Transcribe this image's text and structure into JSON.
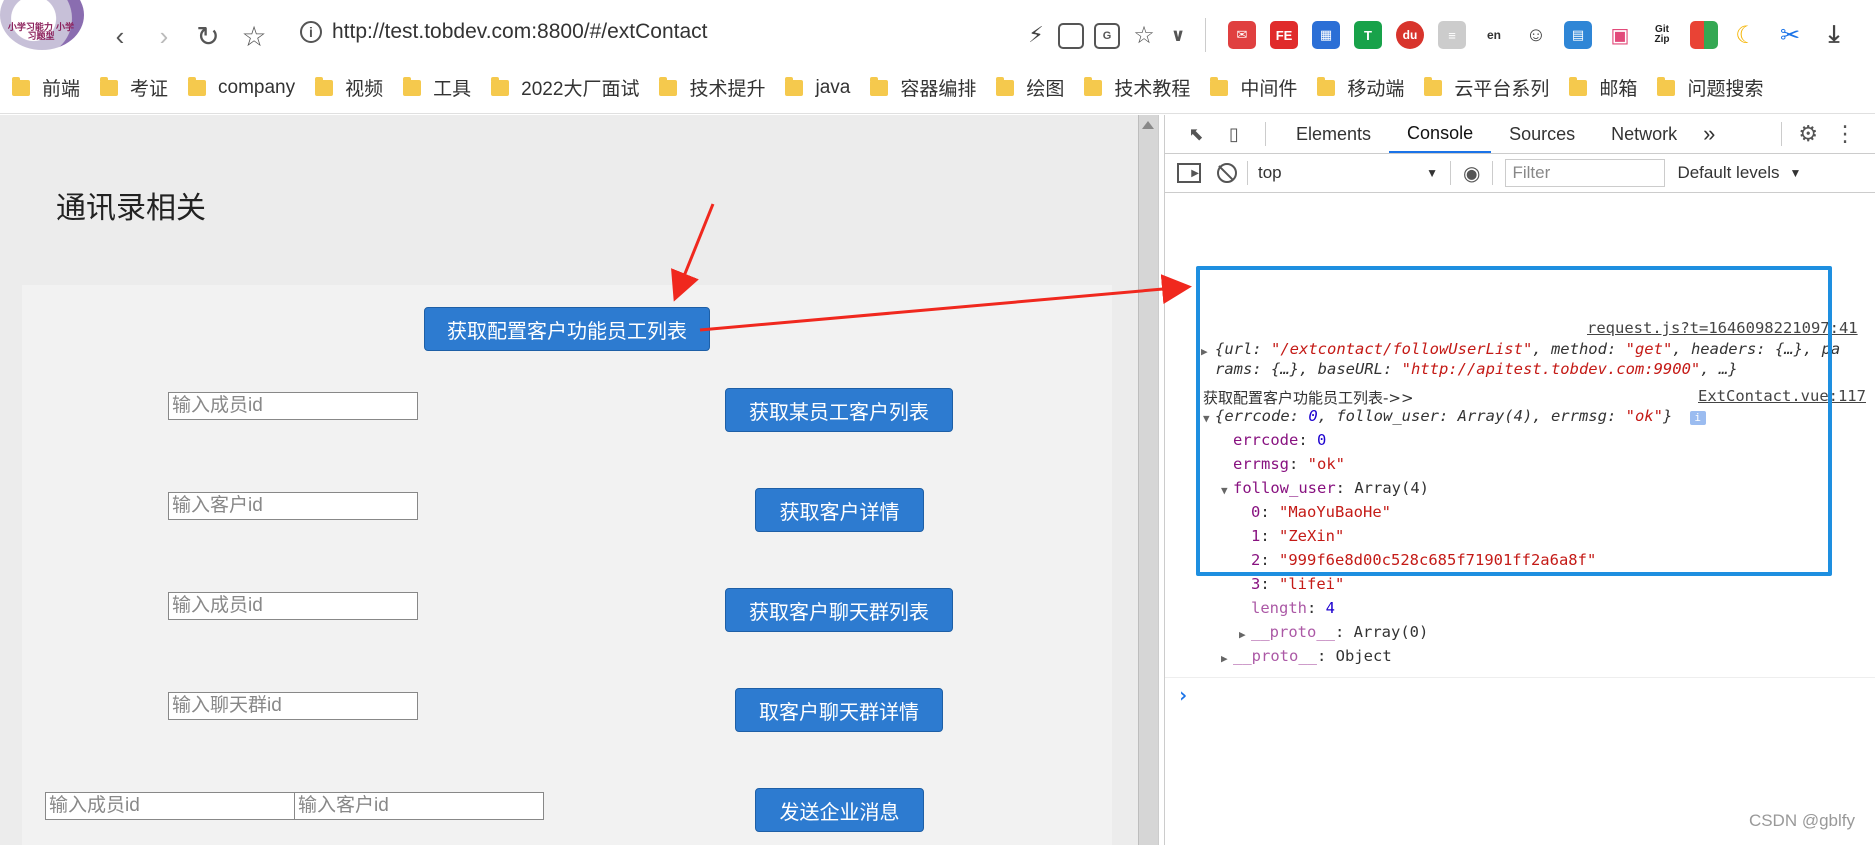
{
  "browser": {
    "url": "http://test.tobdev.com:8800/#/extContact",
    "avatar_text": "小学习能力 小学习题型",
    "extensions": [
      "lightning-icon",
      "qr-grid-icon",
      "translate-icon",
      "star-icon",
      "chevron-down-icon",
      "mail-ext-icon",
      "fe-ext-icon",
      "apps-ext-icon",
      "t-ext-icon",
      "du-ext-icon",
      "book-ext-icon",
      "en-ext-icon",
      "face-ext-icon",
      "sheet-ext-icon",
      "tv-ext-icon",
      "gitzip-ext-icon",
      "grid-ext-icon",
      "moon-ext-icon",
      "scissors-ext-icon",
      "download-icon"
    ],
    "ext_labels": {
      "fe": "FE",
      "du": "du",
      "gitzip": "Git Zip",
      "en": "en"
    }
  },
  "bookmarks": [
    "前端",
    "考证",
    "company",
    "视频",
    "工具",
    "2022大厂面试",
    "技术提升",
    "java",
    "容器编排",
    "绘图",
    "技术教程",
    "中间件",
    "移动端",
    "云平台系列",
    "邮箱",
    "问题搜索"
  ],
  "page": {
    "title": "通讯录相关",
    "btn_follow_users": "获取配置客户功能员工列表",
    "rows": [
      {
        "inputs": [
          "输入成员id"
        ],
        "button": "获取某员工客户列表"
      },
      {
        "inputs": [
          "输入客户id"
        ],
        "button": "获取客户详情"
      },
      {
        "inputs": [
          "输入成员id"
        ],
        "button": "获取客户聊天群列表"
      },
      {
        "inputs": [
          "输入聊天群id"
        ],
        "button": "取客户聊天群详情"
      },
      {
        "inputs": [
          "输入成员id",
          "输入客户id"
        ],
        "button": "发送企业消息"
      }
    ]
  },
  "devtools": {
    "tabs": [
      "Elements",
      "Console",
      "Sources",
      "Network"
    ],
    "active_tab": "Console",
    "more": "»",
    "context": "top",
    "filter_placeholder": "Filter",
    "levels": "Default levels",
    "console": {
      "src1": "request.js?t=1646098221097:41",
      "req_open": "{url: ",
      "req_url": "\"/extcontact/followUserList\"",
      "req_method_key": ", method: ",
      "req_method": "\"get\"",
      "req_rest": ", headers: {…}, pa",
      "req_line2_a": "rams: {…}, baseURL: ",
      "req_baseurl": "\"http://apitest.tobdev.com:9900\"",
      "req_line2_b": ", …}",
      "log_label": "获取配置客户功能员工列表->>",
      "src2": "ExtContact.vue:117",
      "obj_summary_a": "{errcode: ",
      "obj_summary_errcode": "0",
      "obj_summary_b": ", follow_user: Array(4), errmsg: ",
      "obj_summary_errmsg": "\"ok\"",
      "obj_summary_c": "}",
      "errcode_key": "errcode",
      "errcode_val": "0",
      "errmsg_key": "errmsg",
      "errmsg_val": "\"ok\"",
      "follow_key": "follow_user",
      "follow_type": "Array(4)",
      "items": [
        {
          "idx": "0",
          "val": "\"MaoYuBaoHe\""
        },
        {
          "idx": "1",
          "val": "\"ZeXin\""
        },
        {
          "idx": "2",
          "val": "\"999f6e8d00c528c685f71901ff2a6a8f\""
        },
        {
          "idx": "3",
          "val": "\"lifei\""
        }
      ],
      "length_key": "length",
      "length_val": "4",
      "proto_arr_key": "__proto__",
      "proto_arr_val": "Array(0)",
      "proto_obj_key": "__proto__",
      "proto_obj_val": "Object",
      "prompt": "›"
    }
  },
  "watermark": "CSDN @gblfy",
  "colors": {
    "button": "#2d7bd0",
    "highlight": "#1e8fe0",
    "arrow": "#f0281e"
  }
}
